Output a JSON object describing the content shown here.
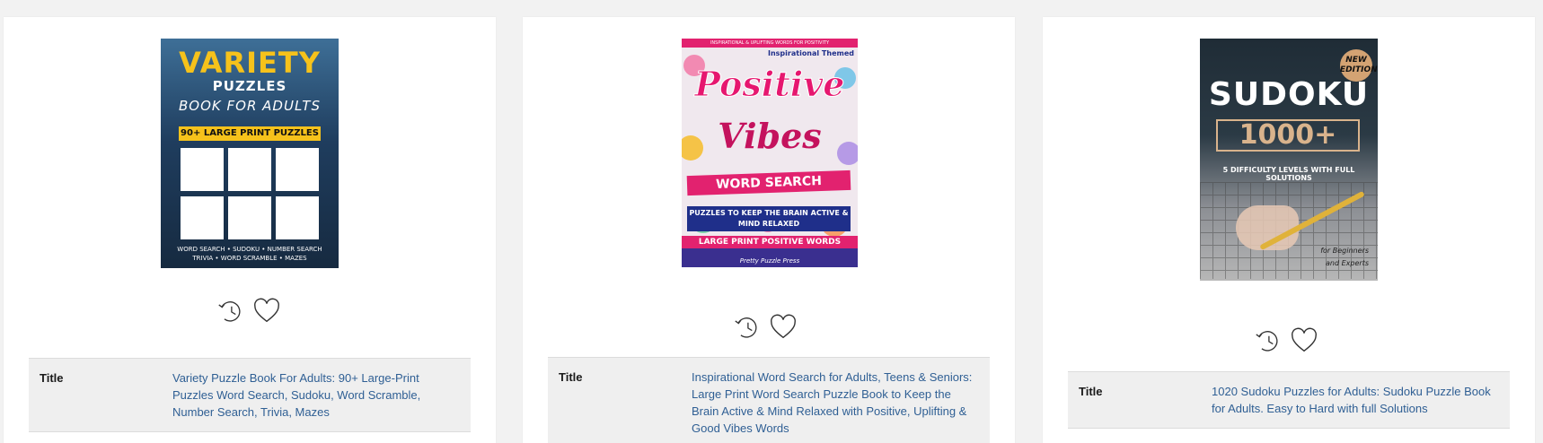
{
  "cards": [
    {
      "cover": {
        "title": "VARIETY",
        "subtitle": "PUZZLES",
        "line3": "BOOK FOR ADULTS",
        "band": "90+ LARGE PRINT PUZZLES",
        "footer_line1": "WORD SEARCH • SUDOKU • NUMBER SEARCH",
        "footer_line2": "TRIVIA • WORD SCRAMBLE • MAZES"
      },
      "label": "Title",
      "title": "Variety Puzzle Book For Adults: 90+ Large-Print Puzzles Word Search, Sudoku, Word Scramble, Number Search, Trivia, Mazes"
    },
    {
      "cover": {
        "top_strip": "INSPIRATIONAL & UPLIFTING WORDS FOR POSITIVITY",
        "themed": "Inspirational Themed",
        "word1": "Positive",
        "word2": "Vibes",
        "banner": "WORD SEARCH",
        "sub": "PUZZLES TO KEEP THE BRAIN ACTIVE & MIND RELAXED",
        "large_print": "LARGE PRINT   POSITIVE WORDS",
        "publisher": "Pretty Puzzle Press"
      },
      "label": "Title",
      "title": "Inspirational Word Search for Adults, Teens & Seniors: Large Print Word Search Puzzle Book to Keep the Brain Active & Mind Relaxed with Positive, Uplifting & Good Vibes Words"
    },
    {
      "cover": {
        "badge": "NEW EDITION",
        "title": "SUDOKU",
        "number": "1000+",
        "sub": "5 DIFFICULTY LEVELS WITH FULL SOLUTIONS",
        "tag_line1": "for Beginners",
        "tag_line2": "and Experts"
      },
      "label": "Title",
      "title": "1020 Sudoku Puzzles for Adults: Sudoku Puzzle Book for Adults. Easy to Hard with full Solutions"
    }
  ],
  "icons": {
    "history": "history-clock-icon",
    "wishlist": "heart-icon"
  },
  "colors": {
    "link": "#2f5f94",
    "row_bg": "#efefef",
    "page_bg": "#f2f2f2"
  }
}
